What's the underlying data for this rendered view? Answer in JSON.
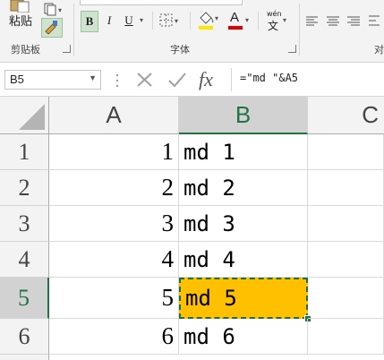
{
  "ribbon": {
    "paste_label": "粘贴",
    "clipboard_group": "剪贴板",
    "font_group": "字体",
    "bold": "B",
    "italic": "I",
    "underline": "U",
    "font_color_letter": "A",
    "phonetic_top": "wén",
    "phonetic_bottom": "文",
    "right_group_label": "对",
    "fill_color": "#ffe600",
    "font_color": "#e00000"
  },
  "formula_bar": {
    "name_box": "B5",
    "formula": "=\"md \"&A5",
    "fx": "fx"
  },
  "columns": [
    "A",
    "B",
    "C"
  ],
  "rows": [
    {
      "num": "1",
      "a": "1",
      "b": "md 1"
    },
    {
      "num": "2",
      "a": "2",
      "b": "md 2"
    },
    {
      "num": "3",
      "a": "3",
      "b": "md 3"
    },
    {
      "num": "4",
      "a": "4",
      "b": "md 4"
    },
    {
      "num": "5",
      "a": "5",
      "b": "md 5"
    },
    {
      "num": "6",
      "a": "6",
      "b": "md 6"
    }
  ],
  "selection": {
    "active_cell": "B5",
    "fill": "#ffc000",
    "header_highlight": "#217346"
  }
}
